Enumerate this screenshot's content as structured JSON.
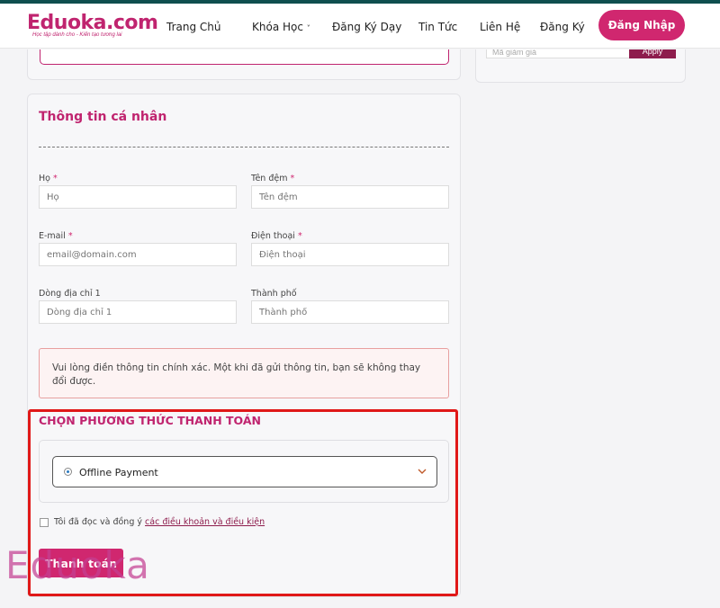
{
  "header": {
    "logo_main": "Eduoka.com",
    "logo_sub": "Học tập dành cho - Kiến tạo tương lai",
    "nav": [
      "Trang Chủ",
      "Khóa Học",
      "Đăng Ký Dạy",
      "Tin Tức",
      "Liên Hệ",
      "Đăng Ký"
    ],
    "login_label": "Đăng Nhập",
    "accent_color": "#d0276f"
  },
  "sidebar": {
    "coupon_placeholder": "Mã giảm giá",
    "apply_label": "Apply"
  },
  "personal": {
    "title": "Thông tin cá nhân",
    "fields": [
      {
        "label": "Họ",
        "required": "*",
        "placeholder": "Họ"
      },
      {
        "label": "Tên đệm",
        "required": "*",
        "placeholder": "Tên đệm"
      },
      {
        "label": "E-mail",
        "required": "*",
        "placeholder": "email@domain.com"
      },
      {
        "label": "Điện thoại",
        "required": "*",
        "placeholder": "Điện thoại"
      },
      {
        "label": "Dòng địa chỉ 1",
        "required": "",
        "placeholder": "Dòng địa chỉ 1"
      },
      {
        "label": "Thành phố",
        "required": "",
        "placeholder": "Thành phố"
      }
    ],
    "notice": "Vui lòng điền thông tin chính xác. Một khi đã gửi thông tin, bạn sẽ không thay đổi được."
  },
  "payment": {
    "title": "CHỌN PHƯƠNG THỨC THANH TOÁN",
    "option": "Offline Payment",
    "terms_prefix": "Tôi đã đọc và đồng ý",
    "terms_link": "các điều khoản và điều kiện",
    "pay_label": "Thanh toán"
  },
  "watermark": "Eduoka"
}
